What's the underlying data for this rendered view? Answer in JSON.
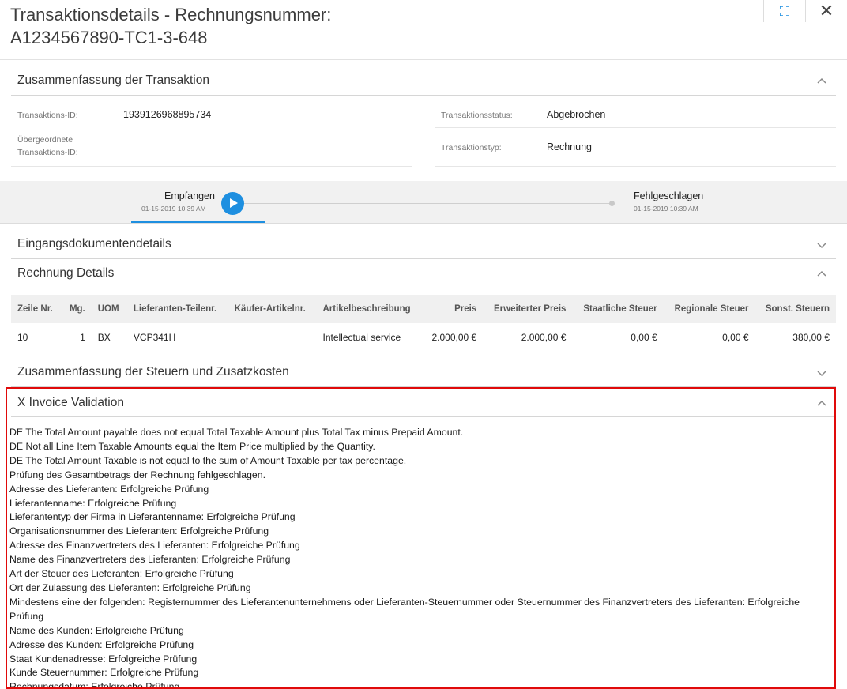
{
  "header": {
    "title_line1": "Transaktionsdetails - Rechnungsnummer:",
    "title_line2": "A1234567890-TC1-3-648",
    "expand_icon": "expand-icon",
    "close_icon": "close-icon",
    "close_glyph": "✕",
    "accent_color": "#1e8fe0"
  },
  "summary": {
    "title": "Zusammenfassung der Transaktion",
    "fields": {
      "id_label": "Transaktions-ID:",
      "id_value": "1939126968895734",
      "parent_label_1": "Übergeordnete",
      "parent_label_2": "Transaktions-ID:",
      "status_label": "Transaktionsstatus:",
      "status_value": "Abgebrochen",
      "type_label": "Transaktionstyp:",
      "type_value": "Rechnung"
    }
  },
  "progress": {
    "steps": [
      {
        "label": "Empfangen",
        "time": "01-15-2019 10:39 AM"
      },
      {
        "label": "Fehlgeschlagen",
        "time": "01-15-2019 10:39 AM"
      }
    ]
  },
  "sections": {
    "input_docs": "Eingangsdokumentendetails",
    "invoice_details": "Rechnung Details",
    "tax_summary": "Zusammenfassung der Steuern und Zusatzkosten",
    "validation": "X Invoice Validation"
  },
  "invoice_table": {
    "columns": [
      "Zeile Nr.",
      "Mg.",
      "UOM",
      "Lieferanten-Teilenr.",
      "Käufer-Artikelnr.",
      "Artikelbeschreibung",
      "Preis",
      "Erweiterter Preis",
      "Staatliche Steuer",
      "Regionale Steuer",
      "Sonst. Steuern"
    ],
    "rows": [
      [
        "10",
        "1",
        "BX",
        "VCP341H",
        "",
        "Intellectual service",
        "2.000,00 €",
        "2.000,00 €",
        "0,00 €",
        "0,00 €",
        "380,00 €"
      ]
    ]
  },
  "validation_messages": [
    "DE The Total Amount payable does not equal Total Taxable Amount plus Total Tax minus Prepaid Amount.",
    "DE Not all Line Item Taxable Amounts equal the Item Price multiplied by the Quantity.",
    "DE The Total Amount Taxable is not equal to the sum of Amount Taxable per tax percentage.",
    "Prüfung des Gesamtbetrags der Rechnung fehlgeschlagen.",
    "Adresse des Lieferanten: Erfolgreiche Prüfung",
    "Lieferantenname: Erfolgreiche Prüfung",
    "Lieferantentyp der Firma in Lieferantenname: Erfolgreiche Prüfung",
    "Organisationsnummer des Lieferanten: Erfolgreiche Prüfung",
    "Adresse des Finanzvertreters des Lieferanten: Erfolgreiche Prüfung",
    "Name des Finanzvertreters des Lieferanten: Erfolgreiche Prüfung",
    "Art der Steuer des Lieferanten: Erfolgreiche Prüfung",
    "Ort der Zulassung des Lieferanten: Erfolgreiche Prüfung",
    "Mindestens eine der folgenden: Registernummer des Lieferantenunternehmens oder Lieferanten-Steuernummer oder Steuernummer des Finanzvertreters des Lieferanten: Erfolgreiche Prüfung",
    "Name des Kunden: Erfolgreiche Prüfung",
    "Adresse des Kunden: Erfolgreiche Prüfung",
    "Staat Kundenadresse: Erfolgreiche Prüfung",
    "Kunde Steuernummer: Erfolgreiche Prüfung",
    "Rechnungsdatum: Erfolgreiche Prüfung"
  ]
}
